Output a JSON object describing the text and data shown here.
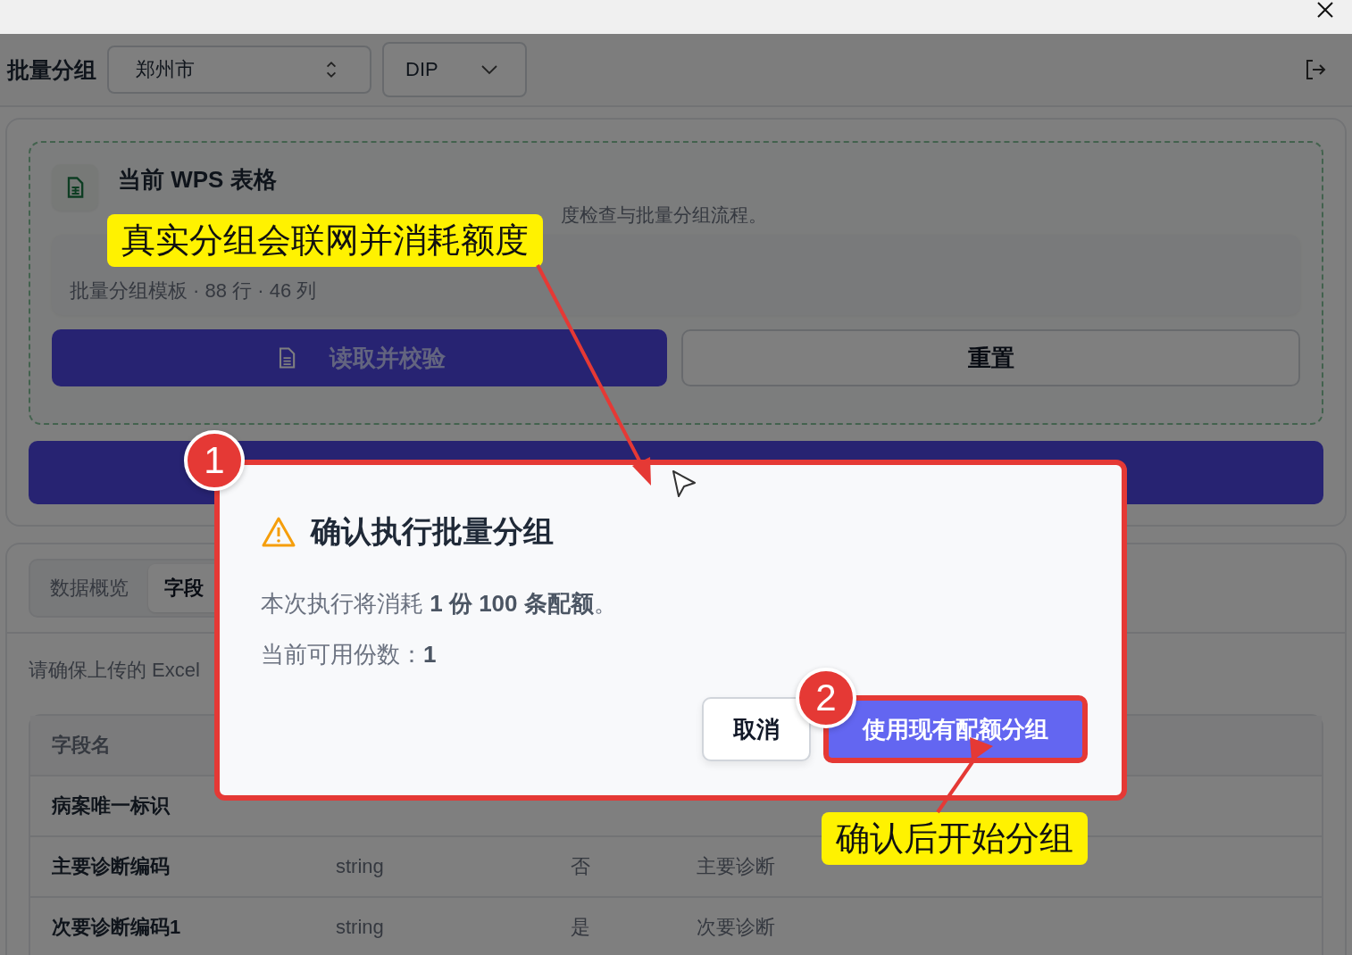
{
  "header": {
    "title": "批量分组",
    "city_select": {
      "value": "郑州市"
    },
    "mode_select": {
      "value": "DIP"
    }
  },
  "source_card": {
    "title": "当前 WPS 表格",
    "description": "度检查与批量分组流程。",
    "sheet": {
      "meta": "批量分组模板 · 88 行 · 46 列"
    },
    "buttons": [
      {
        "label": "读取并校验",
        "kind": "primary"
      },
      {
        "label": "重置",
        "kind": "secondary"
      }
    ]
  },
  "tabs": [
    {
      "label": "数据概览",
      "selected": false
    },
    {
      "label": "字段",
      "selected": true
    }
  ],
  "hint": "请确保上传的 Excel",
  "table": {
    "columns": [
      "字段名"
    ],
    "rows": [
      {
        "name": "病案唯一标识"
      },
      {
        "name": "主要诊断编码",
        "type": "string",
        "required": "否",
        "description": "主要诊断"
      },
      {
        "name": "次要诊断编码1",
        "type": "string",
        "required": "是",
        "description": "次要诊断"
      }
    ]
  },
  "dialog": {
    "title": "确认执行批量分组",
    "lines": [
      "本次执行将消耗 **1 份 100 条配额**。",
      "当前可用份数：**1**"
    ],
    "buttons": [
      {
        "label": "取消",
        "kind": "secondary"
      },
      {
        "label": "使用现有配额分组",
        "kind": "primary"
      }
    ]
  },
  "annotations": {
    "callouts": [
      {
        "text": "真实分组会联网并消耗额度"
      },
      {
        "text": "确认后开始分组"
      }
    ],
    "steps": [
      "1",
      "2"
    ]
  }
}
